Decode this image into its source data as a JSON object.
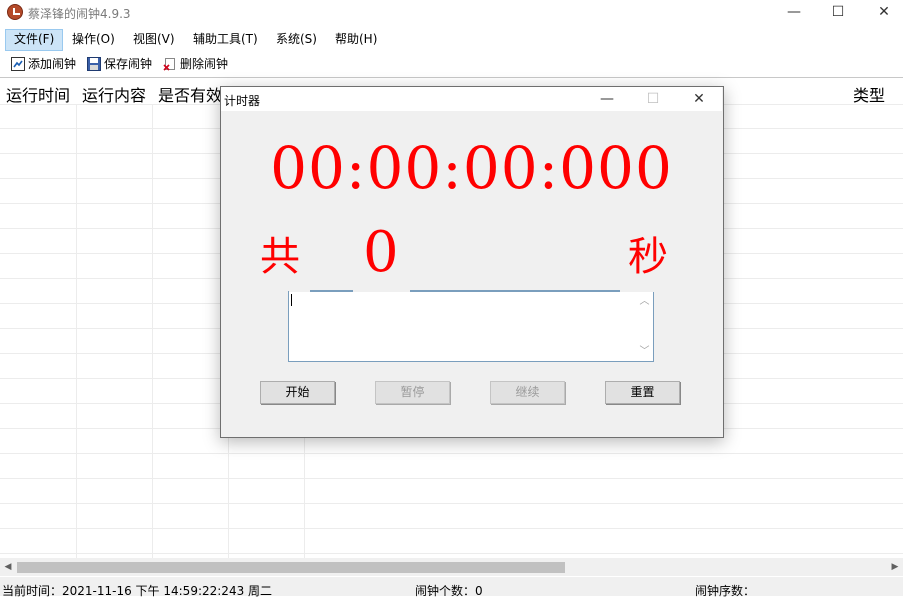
{
  "window": {
    "title": "蔡泽锋的闹钟4.9.3",
    "minimize": "—",
    "maximize": "☐",
    "close": "✕"
  },
  "menu": [
    "文件(F)",
    "操作(O)",
    "视图(V)",
    "辅助工具(T)",
    "系统(S)",
    "帮助(H)"
  ],
  "toolbar": {
    "add": "添加闹钟",
    "save": "保存闹钟",
    "delete": "删除闹钟"
  },
  "list": {
    "columns": [
      "运行时间",
      "运行内容",
      "是否有效",
      "类型"
    ]
  },
  "status": {
    "current_time": "当前时间：2021-11-16 下午 14:59:22:243  周二",
    "alarm_count": "闹钟个数：0",
    "alarm_seq": "闹钟序数："
  },
  "dialog": {
    "title": "计时器",
    "timer": "00:00:00:000",
    "total_label": "共",
    "total_value": "0",
    "seconds_label": "秒",
    "buttons": {
      "start": "开始",
      "pause": "暂停",
      "resume": "继续",
      "reset": "重置"
    }
  },
  "colors": {
    "timer": "#ff0000",
    "menu_highlight": "#cce4f7"
  }
}
